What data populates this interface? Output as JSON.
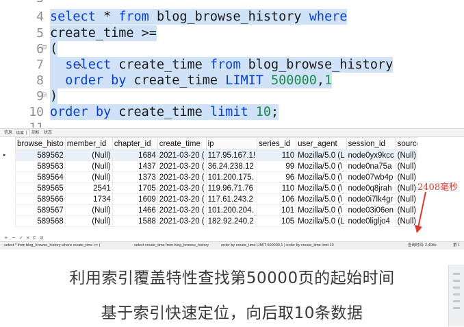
{
  "editor": {
    "lines": [
      {
        "num": "3",
        "segments": []
      },
      {
        "num": "4",
        "segments": [
          {
            "t": "select",
            "k": "kw"
          },
          {
            "t": " * ",
            "k": ""
          },
          {
            "t": "from",
            "k": "kw"
          },
          {
            "t": " blog_browse_history ",
            "k": ""
          },
          {
            "t": "where",
            "k": "kw"
          }
        ]
      },
      {
        "num": "5",
        "segments": [
          {
            "t": "create_time >=",
            "k": ""
          }
        ]
      },
      {
        "num": "6",
        "fold": true,
        "segments": [
          {
            "t": "(",
            "k": ""
          }
        ]
      },
      {
        "num": "7",
        "segments": [
          {
            "t": "  ",
            "k": ""
          },
          {
            "t": "select",
            "k": "kw"
          },
          {
            "t": " create_time ",
            "k": ""
          },
          {
            "t": "from",
            "k": "kw"
          },
          {
            "t": " blog_browse_history",
            "k": ""
          }
        ]
      },
      {
        "num": "8",
        "segments": [
          {
            "t": "  ",
            "k": ""
          },
          {
            "t": "order by",
            "k": "kw"
          },
          {
            "t": " create_time ",
            "k": ""
          },
          {
            "t": "LIMIT",
            "k": "kw"
          },
          {
            "t": " ",
            "k": ""
          },
          {
            "t": "500000",
            "k": "num"
          },
          {
            "t": ",",
            "k": ""
          },
          {
            "t": "1",
            "k": "num"
          }
        ]
      },
      {
        "num": "9",
        "fold": true,
        "segments": [
          {
            "t": ")",
            "k": ""
          }
        ]
      },
      {
        "num": "10",
        "segments": [
          {
            "t": "order by",
            "k": "kw"
          },
          {
            "t": " create_time ",
            "k": ""
          },
          {
            "t": "limit",
            "k": "kw"
          },
          {
            "t": " ",
            "k": ""
          },
          {
            "t": "10",
            "k": "num"
          },
          {
            "t": ";",
            "k": ""
          }
        ]
      },
      {
        "num": "11",
        "segments": []
      }
    ]
  },
  "result_tabs": [
    "信息",
    "结果 1",
    "剖析",
    "状态"
  ],
  "results": {
    "columns": [
      "browse_histo",
      "member_id",
      "chapter_id",
      "create_time",
      "ip",
      "series_id",
      "user_agent",
      "session_id",
      "source"
    ],
    "rows": [
      [
        "589562",
        "(Null)",
        "1684",
        "2021-03-20 (",
        "117.95.167.1!",
        "110",
        "Mozilla/5.0 (L",
        "node0yx9kcc",
        "(Null)"
      ],
      [
        "589563",
        "(Null)",
        "1437",
        "2021-03-20 (",
        "36.24.238.12",
        "99",
        "Mozilla/5.0 (\\",
        "node0na75a",
        "(Null)"
      ],
      [
        "589564",
        "(Null)",
        "1373",
        "2021-03-20 (",
        "101.200.175.",
        "96",
        "Mozilla/5.0 (\\",
        "node07wb4p",
        "(Null)"
      ],
      [
        "589565",
        "2541",
        "1705",
        "2021-03-20 (",
        "119.96.71.76",
        "110",
        "Mozilla/5.0 (\\",
        "node0q8jrah",
        "(Null)"
      ],
      [
        "589566",
        "1734",
        "1609",
        "2021-03-20 (",
        "117.61.243.2",
        "106",
        "Mozilla/5.0 (\\",
        "node0i7lk4gr",
        "(Null)"
      ],
      [
        "589567",
        "(Null)",
        "1466",
        "2021-03-20 (",
        "101.200.204.",
        "101",
        "Mozilla/5.0 (\\",
        "node03i06en",
        "(Null)"
      ],
      [
        "589568",
        "(Null)",
        "1588",
        "2021-03-20 (",
        "182.92.240.2",
        "105",
        "Mozilla/5.0 (L",
        "node0ligljo4",
        "(Null)"
      ]
    ]
  },
  "annotation": {
    "time_text": "2408毫秒",
    "color": "#d93a2b"
  },
  "toolbar": {
    "icons": [
      "add-icon",
      "remove-icon",
      "confirm-icon",
      "cancel-icon",
      "refresh-icon",
      "stop-icon"
    ],
    "glyphs": [
      "+",
      "−",
      "✓",
      "×",
      "C",
      "⊘"
    ]
  },
  "statusbar": {
    "sql_parts": [
      "select * from blog_browse_history where  create_time >= (",
      "select create_time from blog_browse_history",
      "order by create_time LIMIT 500000,1 )  order by create_time limit 10"
    ],
    "query_time": "查询时间: 2.408s",
    "record": "第 1"
  },
  "caption": {
    "line1": "利用索引覆盖特性查找第50000页的起始时间",
    "line2": "基于索引快速定位，向后取10条数据"
  },
  "colors": {
    "keyword": "#0b3fd6",
    "number": "#1c8a4a",
    "selection": "#cfe2f7",
    "null_text": "#b7b7b7"
  }
}
